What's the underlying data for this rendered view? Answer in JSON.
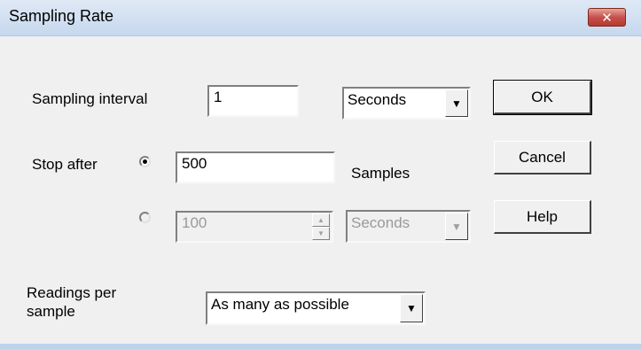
{
  "window": {
    "title": "Sampling Rate",
    "close_glyph": "✕"
  },
  "sampling_interval": {
    "label": "Sampling interval",
    "value": "1",
    "units_selected": "Seconds"
  },
  "stop_after": {
    "label": "Stop after",
    "option_samples": {
      "selected": true,
      "value": "500",
      "units_label": "Samples"
    },
    "option_time": {
      "selected": false,
      "enabled": false,
      "value": "100",
      "units_selected": "Seconds"
    }
  },
  "readings": {
    "label_line1": "Readings per",
    "label_line2": "sample",
    "selected": "As many as possible"
  },
  "buttons": {
    "ok": "OK",
    "cancel": "Cancel",
    "help": "Help"
  },
  "icons": {
    "dropdown": "▼",
    "spin_up": "▲",
    "spin_down": "▼"
  }
}
